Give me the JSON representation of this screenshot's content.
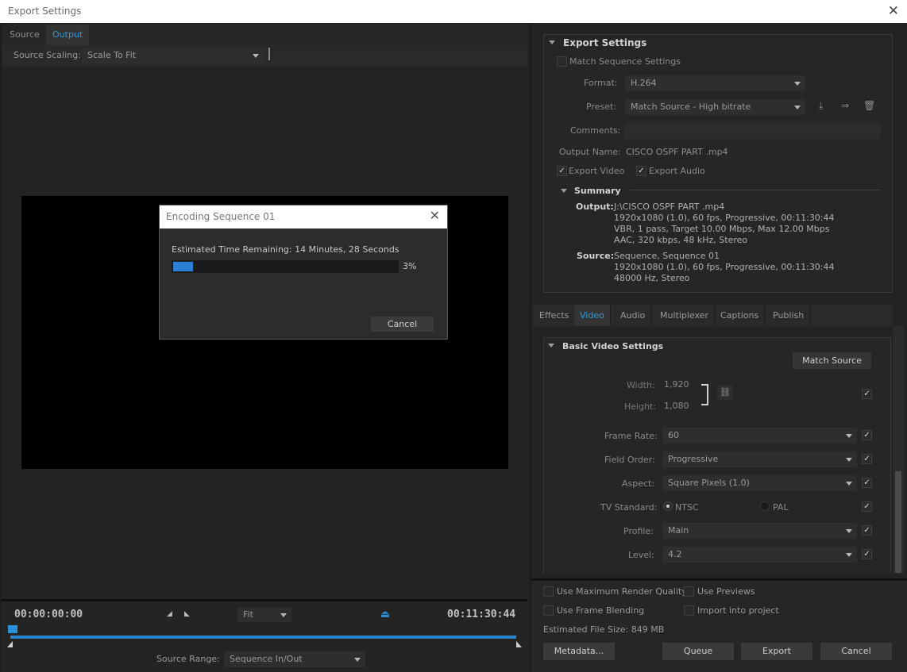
{
  "window": {
    "title": "Export Settings"
  },
  "left": {
    "tabs": [
      "Source",
      "Output"
    ],
    "source_scaling_label": "Source Scaling:",
    "source_scaling_value": "Scale To Fit"
  },
  "encoding_dialog": {
    "title": "Encoding Sequence 01",
    "remaining": "Estimated Time Remaining: 14 Minutes, 28 Seconds",
    "percent_label": "3%",
    "progress_fraction": 0.03,
    "cancel": "Cancel"
  },
  "timeline": {
    "start_tc": "00:00:00:00",
    "end_tc": "00:11:30:44",
    "zoom_value": "Fit",
    "source_range_label": "Source Range:",
    "source_range_value": "Sequence In/Out"
  },
  "export_settings": {
    "header": "Export Settings",
    "match_sequence": "Match Sequence Settings",
    "format_label": "Format:",
    "format_value": "H.264",
    "preset_label": "Preset:",
    "preset_value": "Match Source - High bitrate",
    "comments_label": "Comments:",
    "output_name_label": "Output Name:",
    "output_name_value": "CISCO OSPF PART .mp4",
    "export_video": "Export Video",
    "export_audio": "Export Audio",
    "summary_header": "Summary",
    "output_label": "Output:",
    "output_lines": [
      "J:\\CISCO OSPF PART .mp4",
      "1920x1080 (1.0), 60 fps, Progressive, 00:11:30:44",
      "VBR, 1 pass, Target 10.00 Mbps, Max 12.00 Mbps",
      "AAC, 320 kbps, 48 kHz, Stereo"
    ],
    "source_label": "Source:",
    "source_lines": [
      "Sequence, Sequence 01",
      "1920x1080 (1.0), 60 fps, Progressive, 00:11:30:44",
      "48000 Hz, Stereo"
    ]
  },
  "right_tabs": [
    "Effects",
    "Video",
    "Audio",
    "Multiplexer",
    "Captions",
    "Publish"
  ],
  "video": {
    "header": "Basic Video Settings",
    "match_source": "Match Source",
    "width_label": "Width:",
    "width_value": "1,920",
    "height_label": "Height:",
    "height_value": "1,080",
    "frame_rate_label": "Frame Rate:",
    "frame_rate_value": "60",
    "field_order_label": "Field Order:",
    "field_order_value": "Progressive",
    "aspect_label": "Aspect:",
    "aspect_value": "Square Pixels (1.0)",
    "tv_standard_label": "TV Standard:",
    "ntsc": "NTSC",
    "pal": "PAL",
    "profile_label": "Profile:",
    "profile_value": "Main",
    "level_label": "Level:",
    "level_value": "4.2"
  },
  "bottom": {
    "use_max_render": "Use Maximum Render Quality",
    "use_previews": "Use Previews",
    "use_frame_blending": "Use Frame Blending",
    "import_into_project": "Import into project",
    "file_size": "Estimated File Size:  849 MB",
    "metadata": "Metadata...",
    "queue": "Queue",
    "export": "Export",
    "cancel": "Cancel"
  },
  "colors": {
    "accent": "#2d9cdb",
    "progress": "#2a7fd6",
    "timeline": "#2b83c9"
  },
  "icons": [
    "close-icon",
    "import-preset-icon",
    "save-preset-icon",
    "delete-preset-icon",
    "link-icon",
    "checkmark-icon",
    "chevron-down-icon",
    "playhead-icon"
  ]
}
